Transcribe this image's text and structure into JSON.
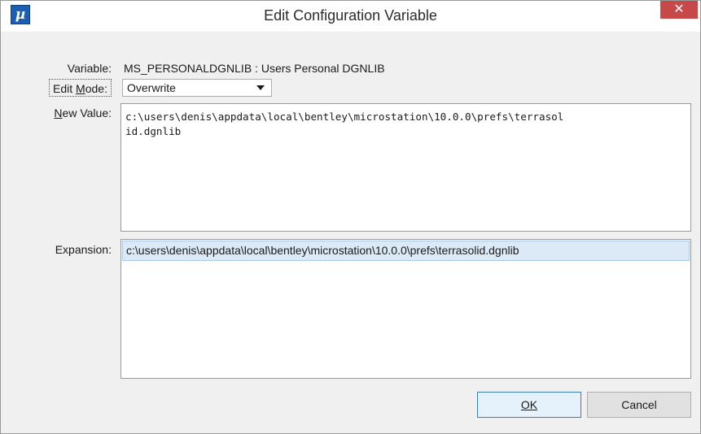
{
  "window": {
    "title": "Edit Configuration Variable",
    "app_icon_glyph": "µ",
    "close_glyph": "✕"
  },
  "form": {
    "variable_label": "Variable:",
    "variable_value": "MS_PERSONALDGNLIB : Users Personal DGNLIB",
    "edit_mode_label_pre": "Edit ",
    "edit_mode_label_key": "M",
    "edit_mode_label_post": "ode:",
    "edit_mode_value": "Overwrite",
    "new_value_label_key": "N",
    "new_value_label_post": "ew Value:",
    "new_value_text": "c:\\users\\denis\\appdata\\local\\bentley\\microstation\\10.0.0\\prefs\\terrasol\nid.dgnlib",
    "expansion_label": "Expansion:",
    "expansion_items": [
      "c:\\users\\denis\\appdata\\local\\bentley\\microstation\\10.0.0\\prefs\\terrasolid.dgnlib"
    ]
  },
  "buttons": {
    "ok_label": "OK",
    "cancel_label": "Cancel"
  },
  "colors": {
    "close_button": "#c74848",
    "app_icon": "#1b5fb3",
    "selected_row": "#dce9f7",
    "default_button_border": "#3c7fb1"
  },
  "icons": {
    "app": "microstation-app-icon",
    "close": "close-icon",
    "dropdown": "chevron-down-icon"
  }
}
